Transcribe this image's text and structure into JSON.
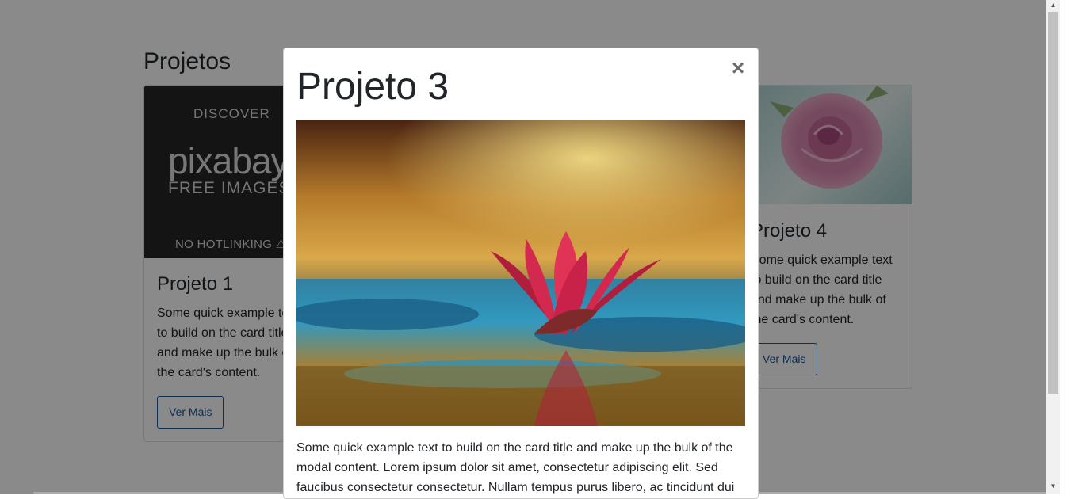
{
  "page": {
    "section_title": "Projetos"
  },
  "cards": [
    {
      "title": "Projeto 1",
      "text": "Some quick example text to build on the card title and make up the bulk of the card's content.",
      "button": "Ver Mais",
      "image": {
        "discover": "DISCOVER",
        "logo": "pixabay",
        "free": "FREE IMAGES",
        "nohotlink": "NO HOTLINKING ⚠"
      }
    },
    {
      "title": "Projeto 4",
      "text": "Some quick example text to build on the card title and make up the bulk of the card's content.",
      "button": "Ver Mais",
      "image_subject": "pink-rose"
    }
  ],
  "modal": {
    "title": "Projeto 3",
    "close_glyph": "×",
    "image_subject": "red-water-lily",
    "text": "Some quick example text to build on the card title and make up the bulk of the modal content. Lorem ipsum dolor sit amet, consectetur adipiscing elit. Sed faucibus consectetur consectetur. Nullam tempus purus libero, ac tincidunt dui"
  },
  "colors": {
    "overlay": "#000000",
    "button_outline": "#17579a"
  }
}
